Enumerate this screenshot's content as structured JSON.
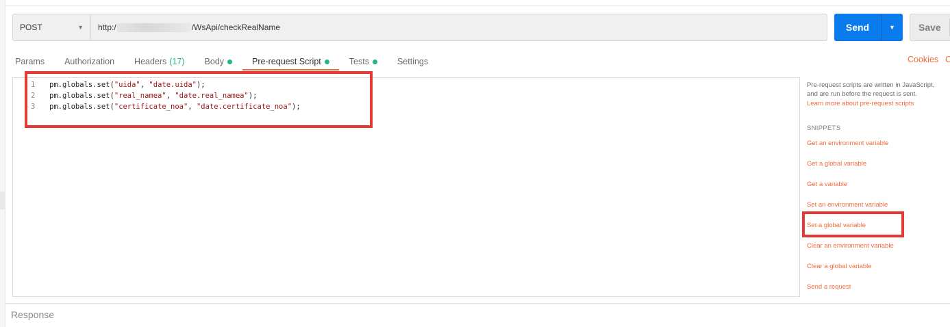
{
  "request": {
    "method": "POST",
    "url_prefix": "http:/",
    "url_suffix": "/WsApi/checkRealName",
    "send_label": "Send",
    "save_label": "Save"
  },
  "tabs": [
    {
      "label": "Params"
    },
    {
      "label": "Authorization"
    },
    {
      "label": "Headers",
      "count": "(17)"
    },
    {
      "label": "Body",
      "dot": true
    },
    {
      "label": "Pre-request Script",
      "dot": true,
      "active": true
    },
    {
      "label": "Tests",
      "dot": true
    },
    {
      "label": "Settings"
    }
  ],
  "cookies_label": "Cookies",
  "code_label": "C",
  "editor": {
    "lines": [
      {
        "no": "1",
        "prefix": "pm.globals.set(",
        "arg1": "\"uida\"",
        "sep": ", ",
        "arg2": "\"date.uida\"",
        "suffix": ");"
      },
      {
        "no": "2",
        "prefix": "pm.globals.set(",
        "arg1": "\"real_namea\"",
        "sep": ", ",
        "arg2": "\"date.real_namea\"",
        "suffix": ");"
      },
      {
        "no": "3",
        "prefix": "pm.globals.set(",
        "arg1": "\"certificate_noa\"",
        "sep": ", ",
        "arg2": "\"date.certificate_noa\"",
        "suffix": ");"
      }
    ]
  },
  "side_panel": {
    "desc_line1": "Pre-request scripts are written in JavaScript,",
    "desc_line2": "and are run before the request is sent.",
    "learn_more": "Learn more about pre-request scripts",
    "snippets_heading": "SNIPPETS",
    "snippets": [
      "Get an environment variable",
      "Get a global variable",
      "Get a variable",
      "Set an environment variable",
      "Set a global variable",
      "Clear an environment variable",
      "Clear a global variable",
      "Send a request"
    ]
  },
  "response_label": "Response",
  "colors": {
    "accent": "#f26b3a",
    "send_button": "#097bed",
    "status_dot": "#26b47f",
    "annotation": "#e53935"
  }
}
